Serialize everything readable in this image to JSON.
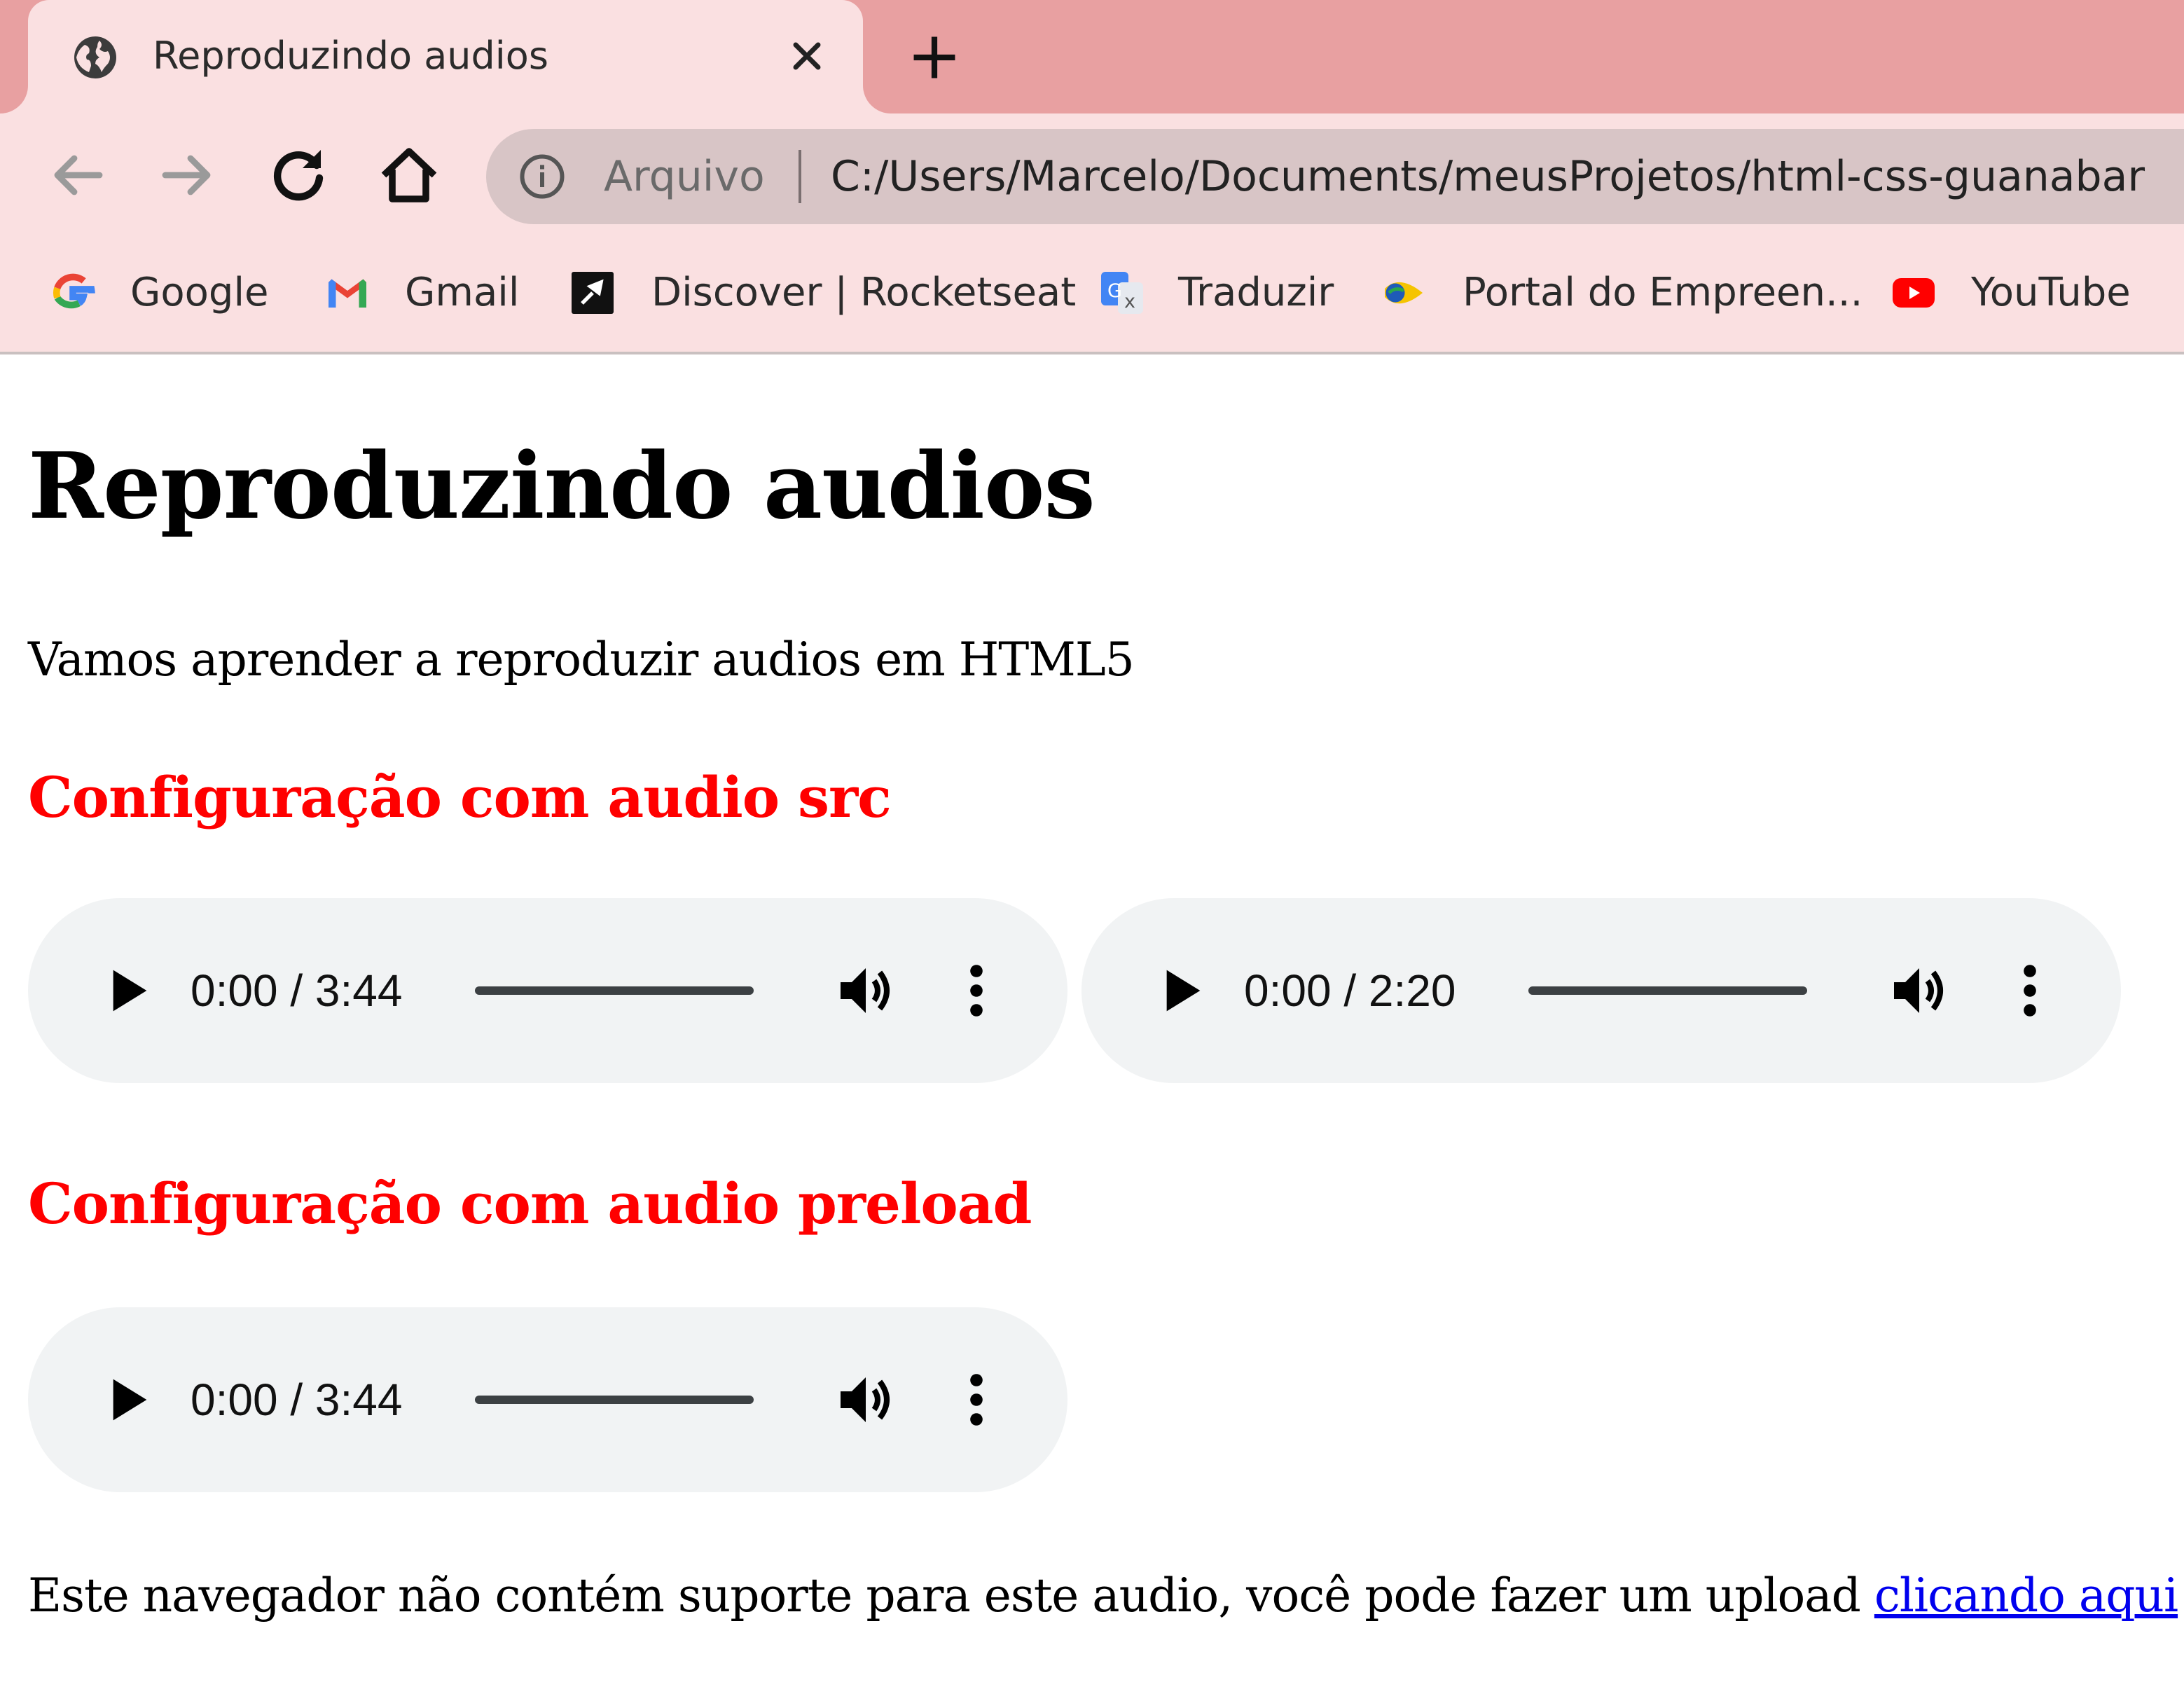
{
  "browser": {
    "tab": {
      "title": "Reproduzindo audios",
      "favicon": "globe-icon"
    },
    "omnibox": {
      "scheme_label": "Arquivo",
      "url": "C:/Users/Marcelo/Documents/meusProjetos/html-css-guanabar"
    },
    "bookmarks": [
      {
        "label": "Google",
        "icon": "google-icon"
      },
      {
        "label": "Gmail",
        "icon": "gmail-icon"
      },
      {
        "label": "Discover | Rocketseat",
        "icon": "rocketseat-icon"
      },
      {
        "label": "Traduzir",
        "icon": "translate-icon"
      },
      {
        "label": "Portal do Empreen...",
        "icon": "portal-icon"
      },
      {
        "label": "YouTube",
        "icon": "youtube-icon"
      }
    ]
  },
  "page": {
    "title": "Reproduzindo audios",
    "intro": "Vamos aprender a reproduzir audios em HTML5",
    "section1_heading": "Configuração com audio src",
    "section2_heading": "Configuração com audio preload",
    "players": [
      {
        "time": "0:00 / 3:44"
      },
      {
        "time": "0:00 / 2:20"
      },
      {
        "time": "0:00 / 3:44"
      }
    ],
    "fallback_text": "Este navegador não contém suporte para este audio, você pode fazer um upload ",
    "fallback_link": "clicando aqui"
  },
  "colors": {
    "tabstrip": "#e8a0a1",
    "chrome": "#fae0e1",
    "heading_red": "#ff0000",
    "link": "#0000ee",
    "player_bg": "#f1f3f4"
  }
}
